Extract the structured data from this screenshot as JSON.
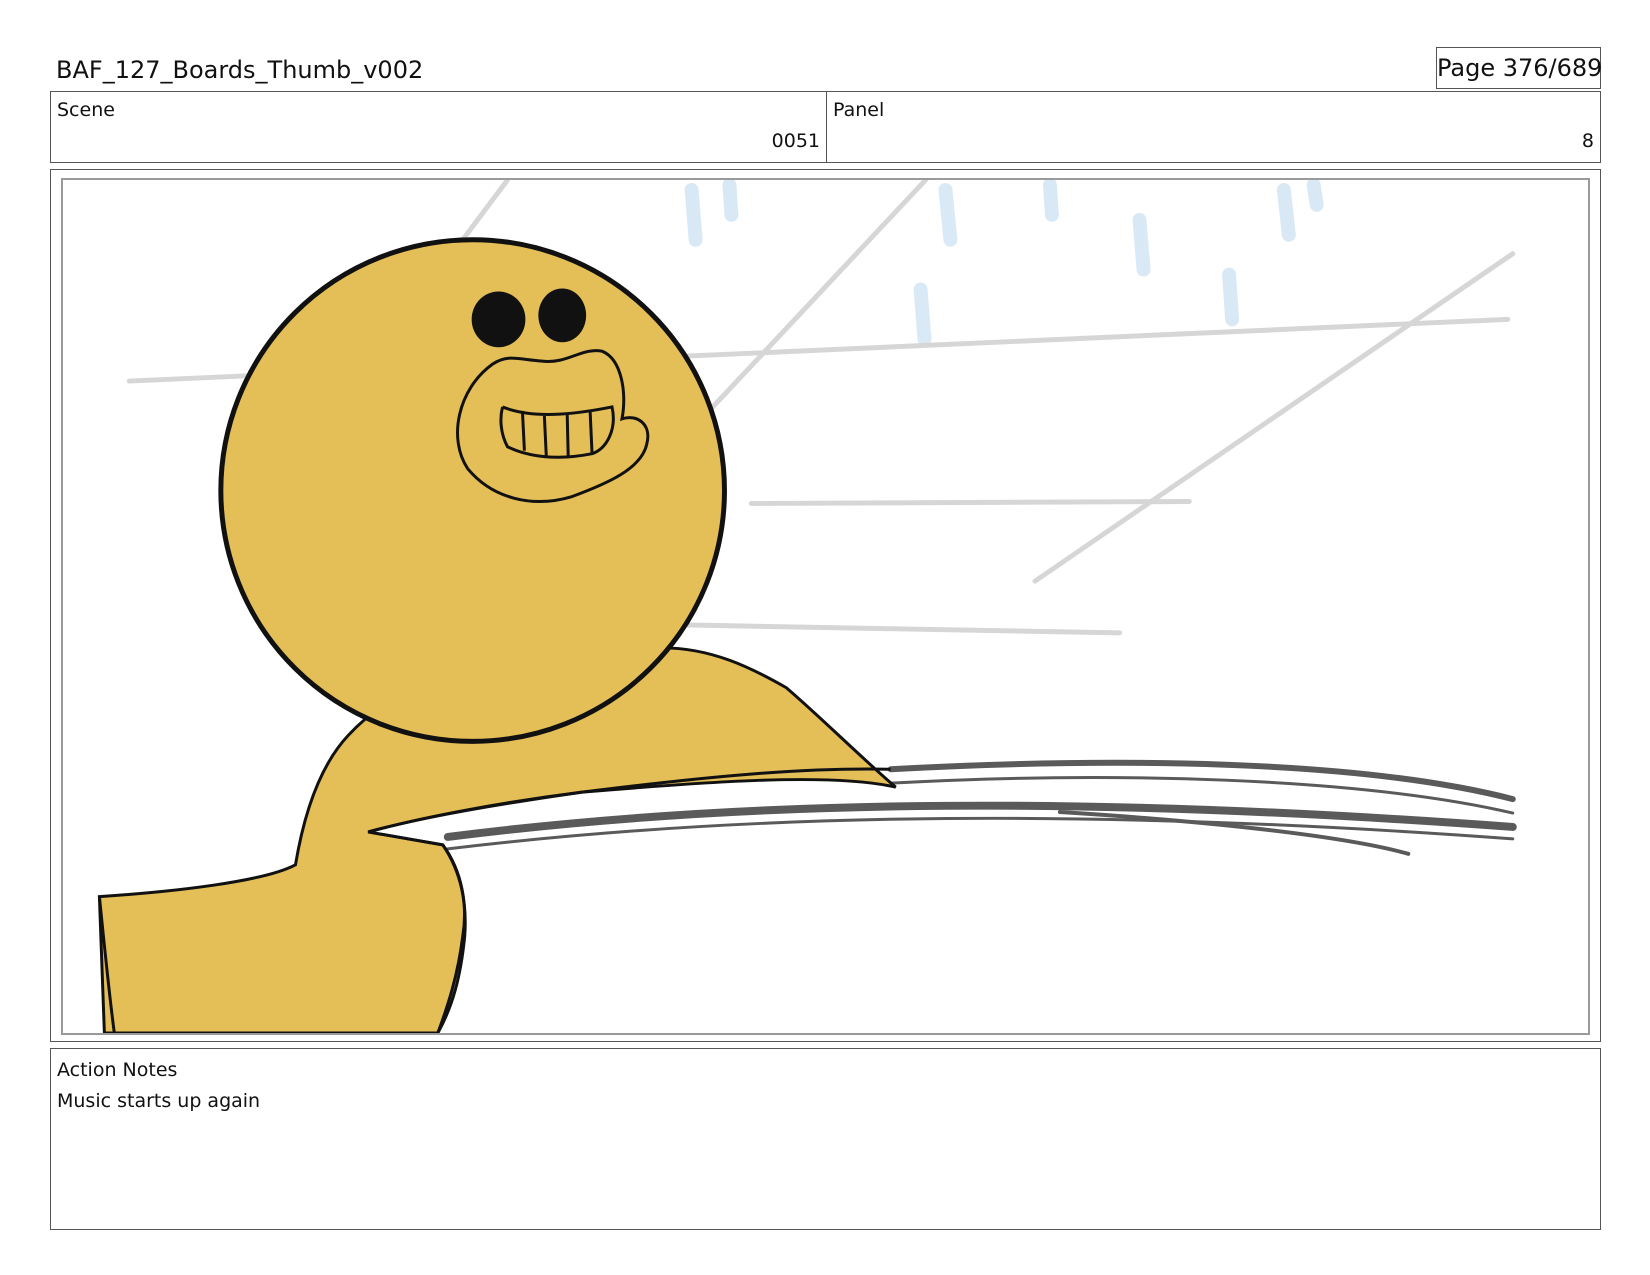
{
  "header": {
    "title": "BAF_127_Boards_Thumb_v002",
    "page": "Page 376/689"
  },
  "scene": {
    "label": "Scene",
    "value": "0051"
  },
  "panel": {
    "label": "Panel",
    "value": "8"
  },
  "frame": {
    "character_color": "#e4bf57",
    "line_color": "#111111",
    "sketch_color": "#d6d6d6",
    "speed_line_color": "#5a5a5a",
    "rain_color": "#cfe3f3"
  },
  "action_notes": {
    "label": "Action Notes",
    "text": "Music starts up again"
  }
}
